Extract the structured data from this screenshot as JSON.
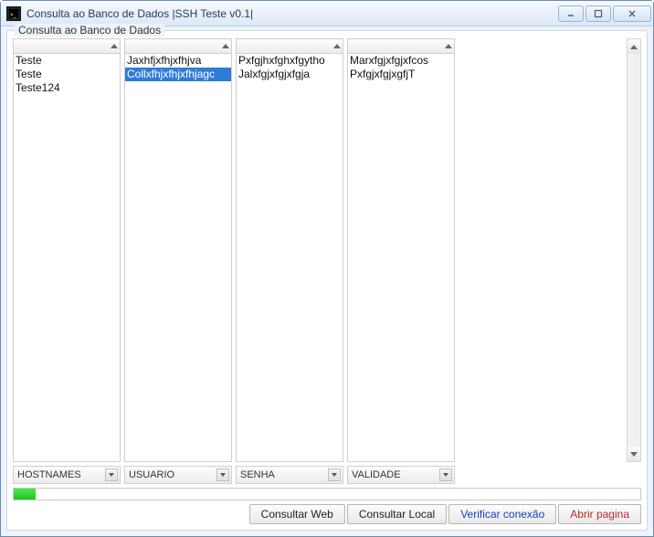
{
  "window": {
    "title": "Consulta ao Banco de Dados |SSH Teste v0.1|"
  },
  "group": {
    "label": "Consulta ao Banco de Dados"
  },
  "columns": {
    "hostnames": {
      "label": "HOSTNAMES",
      "items": [
        "Teste",
        "Teste",
        "Teste124"
      ],
      "selected_index": -1
    },
    "usuario": {
      "label": "USUARIO",
      "items": [
        "Jaxhfjxfhjxfhjva",
        "Collxfhjxfhjxfhjagc"
      ],
      "selected_index": 1
    },
    "senha": {
      "label": "SENHA",
      "items": [
        "Pxfgjhxfghxfgytho",
        "Jalxfgjxfgjxfgja"
      ],
      "selected_index": -1
    },
    "validade": {
      "label": "VALIDADE",
      "items": [
        "Marxfgjxfgjxfcos",
        "PxfgjxfgjxgfjT"
      ],
      "selected_index": -1
    }
  },
  "buttons": {
    "consultar_web": "Consultar Web",
    "consultar_local": "Consultar Local",
    "verificar_conexao": "Verificar conexão",
    "abrir_pagina": "Abrir pagina"
  }
}
